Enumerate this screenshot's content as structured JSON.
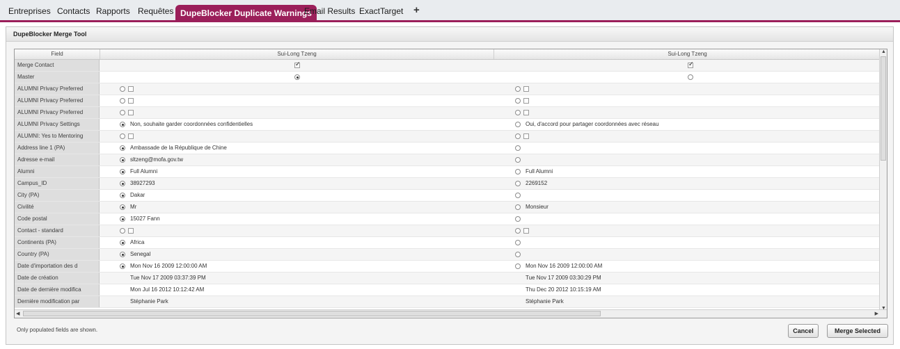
{
  "tabs": [
    {
      "label": "Entreprises"
    },
    {
      "label": "Contacts"
    },
    {
      "label": "Rapports"
    },
    {
      "label": "Requêtes"
    },
    {
      "label": "DupeBlocker Duplicate Warnings",
      "active": true
    },
    {
      "label": "Email Results"
    },
    {
      "label": "ExactTarget"
    }
  ],
  "add_tab_symbol": "+",
  "panel": {
    "title": "DupeBlocker Merge Tool"
  },
  "grid": {
    "headers": {
      "field": "Field",
      "record1": "Sui-Long Tzeng",
      "record2": "Sui-Long Tzeng"
    },
    "rows": [
      {
        "field": "Merge Contact",
        "type": "merge"
      },
      {
        "field": "Master",
        "type": "master"
      },
      {
        "field": "ALUMNI Privacy Preferred",
        "type": "checkbox"
      },
      {
        "field": "ALUMNI Privacy Preferred",
        "type": "checkbox"
      },
      {
        "field": "ALUMNI Privacy Preferred",
        "type": "checkbox"
      },
      {
        "field": "ALUMNI Privacy Settings",
        "type": "radio",
        "v1": "Non, souhaite garder coordonnées confidentielles",
        "v2": "Oui, d'accord pour partager coordonnées avec réseau",
        "sel": 1
      },
      {
        "field": "ALUMNI: Yes to Mentoring",
        "type": "checkbox"
      },
      {
        "field": "Address line 1 (PA)",
        "type": "radio",
        "v1": "Ambassade de la République de Chine",
        "v2": "",
        "sel": 1
      },
      {
        "field": "Adresse e-mail",
        "type": "radio",
        "v1": "sltzeng@mofa.gov.tw",
        "v2": "",
        "sel": 1
      },
      {
        "field": "Alumni",
        "type": "radio",
        "v1": "Full Alumni",
        "v2": "Full Alumni",
        "sel": 1
      },
      {
        "field": "Campus_ID",
        "type": "radio",
        "v1": "38927293",
        "v2": "2269152",
        "sel": 1
      },
      {
        "field": "City (PA)",
        "type": "radio",
        "v1": "Dakar",
        "v2": "",
        "sel": 1
      },
      {
        "field": "Civilité",
        "type": "radio",
        "v1": "Mr",
        "v2": "Monsieur",
        "sel": 1
      },
      {
        "field": "Code postal",
        "type": "radio",
        "v1": "15027 Fann",
        "v2": "",
        "sel": 1
      },
      {
        "field": "Contact - standard",
        "type": "checkbox"
      },
      {
        "field": "Continents (PA)",
        "type": "radio",
        "v1": "Africa",
        "v2": "",
        "sel": 1
      },
      {
        "field": "Country (PA)",
        "type": "radio",
        "v1": "Senegal",
        "v2": "",
        "sel": 1
      },
      {
        "field": "Date d'importation des d",
        "type": "radio",
        "v1": "Mon Nov 16 2009 12:00:00 AM",
        "v2": "Mon Nov 16 2009 12:00:00 AM",
        "sel": 1
      },
      {
        "field": "Date de création",
        "type": "text",
        "v1": "Tue Nov 17 2009 03:37:39 PM",
        "v2": "Tue Nov 17 2009 03:30:29 PM"
      },
      {
        "field": "Date de dernière modifica",
        "type": "text",
        "v1": "Mon Jul 16 2012 10:12:42 AM",
        "v2": "Thu Dec 20 2012 10:15:19 AM"
      },
      {
        "field": "Dernière modification par",
        "type": "text",
        "v1": "Stéphanie Park",
        "v2": "Stéphanie Park"
      }
    ]
  },
  "footer": {
    "note": "Only populated fields are shown.",
    "cancel_label": "Cancel",
    "merge_label": "Merge Selected"
  },
  "colors": {
    "accent": "#9b1f5a"
  }
}
